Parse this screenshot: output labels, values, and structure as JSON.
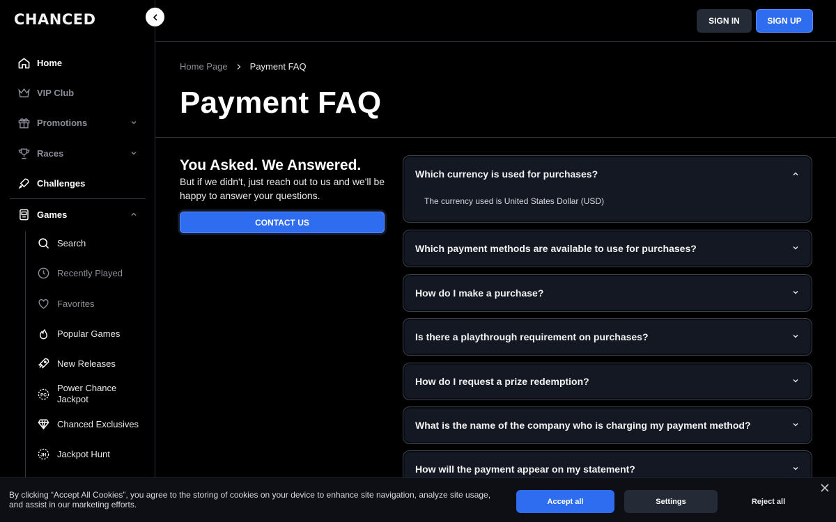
{
  "brand": {
    "logo": "CHANCED"
  },
  "sidebar": {
    "items": [
      {
        "label": "Home"
      },
      {
        "label": "VIP Club"
      },
      {
        "label": "Promotions"
      },
      {
        "label": "Races"
      },
      {
        "label": "Challenges"
      },
      {
        "label": "Games"
      }
    ],
    "games_sub": [
      {
        "label": "Search"
      },
      {
        "label": "Recently Played"
      },
      {
        "label": "Favorites"
      },
      {
        "label": "Popular Games"
      },
      {
        "label": "New Releases"
      },
      {
        "label": "Power Chance Jackpot"
      },
      {
        "label": "Chanced Exclusives"
      },
      {
        "label": "Jackpot Hunt"
      }
    ]
  },
  "header": {
    "signin_label": "SIGN IN",
    "signup_label": "SIGN UP"
  },
  "breadcrumb": {
    "home": "Home Page",
    "current": "Payment FAQ"
  },
  "page": {
    "title": "Payment FAQ"
  },
  "cta": {
    "heading": "You Asked. We Answered.",
    "subtext": "But if we didn't, just reach out to us and we'll be happy to answer your questions.",
    "button": "CONTACT US"
  },
  "faq": [
    {
      "question": "Which currency is used for purchases?",
      "answer": "The currency used is United States Dollar (USD)",
      "expanded": true
    },
    {
      "question": "Which payment methods are available to use for purchases?",
      "expanded": false
    },
    {
      "question": "How do I make a purchase?",
      "expanded": false
    },
    {
      "question": "Is there a playthrough requirement on purchases?",
      "expanded": false
    },
    {
      "question": "How do I request a prize redemption?",
      "expanded": false
    },
    {
      "question": "What is the name of the company who is charging my payment method?",
      "expanded": false
    },
    {
      "question": "How will the payment appear on my statement?",
      "expanded": false
    }
  ],
  "cookie": {
    "text": "By clicking “Accept All Cookies”, you agree to the storing of cookies on your device to enhance site navigation, analyze site usage, and assist in our marketing efforts.",
    "accept": "Accept all",
    "settings": "Settings",
    "reject": "Reject all"
  },
  "colors": {
    "accent": "#2e6cf0",
    "background": "#000000",
    "card": "#141822"
  }
}
